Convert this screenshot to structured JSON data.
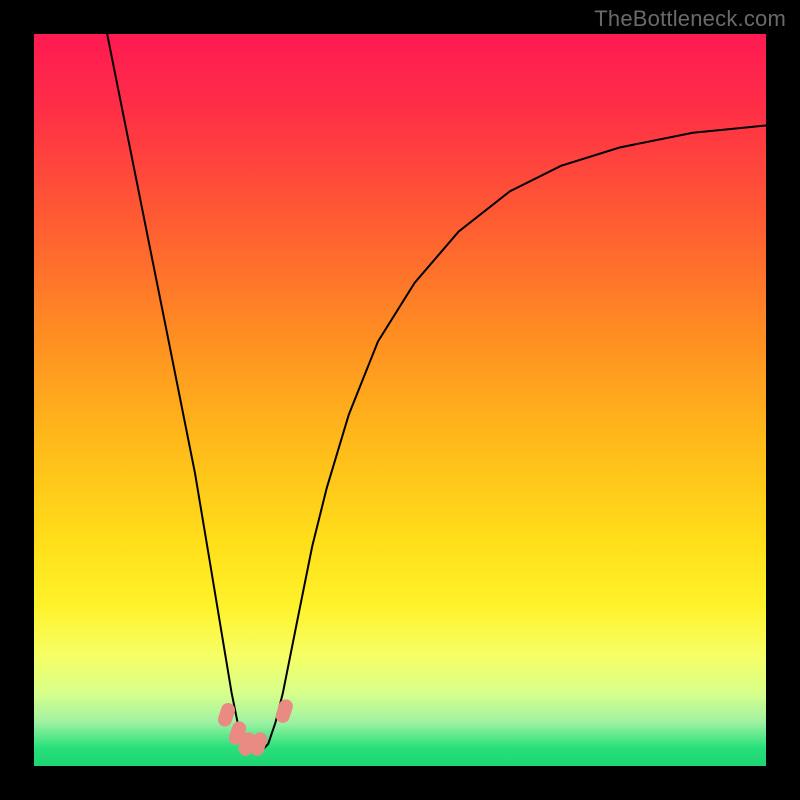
{
  "watermark": "TheBottleneck.com",
  "chart_data": {
    "type": "line",
    "title": "",
    "xlabel": "",
    "ylabel": "",
    "xlim": [
      0,
      100
    ],
    "ylim": [
      0,
      100
    ],
    "legend": false,
    "grid": false,
    "background_gradient": {
      "stops": [
        {
          "offset": 0.0,
          "color": "#ff1a52"
        },
        {
          "offset": 0.1,
          "color": "#ff2e47"
        },
        {
          "offset": 0.25,
          "color": "#ff5a33"
        },
        {
          "offset": 0.4,
          "color": "#ff8a23"
        },
        {
          "offset": 0.55,
          "color": "#ffb81a"
        },
        {
          "offset": 0.7,
          "color": "#ffe01a"
        },
        {
          "offset": 0.78,
          "color": "#fff22a"
        },
        {
          "offset": 0.85,
          "color": "#f6ff66"
        },
        {
          "offset": 0.9,
          "color": "#d8ff8a"
        },
        {
          "offset": 0.94,
          "color": "#9ff2a2"
        },
        {
          "offset": 0.975,
          "color": "#28e07a"
        },
        {
          "offset": 1.0,
          "color": "#1cd672"
        }
      ]
    },
    "series": [
      {
        "name": "bottleneck-curve",
        "color": "#000000",
        "width": 2,
        "x": [
          10.0,
          12.0,
          14.0,
          16.0,
          18.0,
          20.0,
          22.0,
          24.0,
          25.0,
          26.0,
          27.0,
          28.0,
          29.0,
          30.0,
          31.0,
          32.0,
          33.0,
          34.0,
          35.0,
          36.0,
          38.0,
          40.0,
          43.0,
          47.0,
          52.0,
          58.0,
          65.0,
          72.0,
          80.0,
          90.0,
          100.0
        ],
        "y": [
          100.0,
          90.0,
          80.0,
          70.0,
          60.0,
          50.0,
          40.0,
          28.0,
          22.0,
          16.0,
          10.0,
          5.0,
          3.0,
          2.0,
          2.0,
          3.0,
          6.0,
          10.0,
          15.0,
          20.0,
          30.0,
          38.0,
          48.0,
          58.0,
          66.0,
          73.0,
          78.5,
          82.0,
          84.5,
          86.5,
          87.5
        ]
      }
    ],
    "markers": [
      {
        "x": 26.3,
        "y": 7.0,
        "color": "#e98b82",
        "size": 10
      },
      {
        "x": 27.8,
        "y": 4.5,
        "color": "#e98b82",
        "size": 10
      },
      {
        "x": 29.1,
        "y": 3.0,
        "color": "#e98b82",
        "size": 10
      },
      {
        "x": 30.7,
        "y": 3.0,
        "color": "#e98b82",
        "size": 10
      },
      {
        "x": 34.2,
        "y": 7.5,
        "color": "#e98b82",
        "size": 10
      }
    ]
  }
}
